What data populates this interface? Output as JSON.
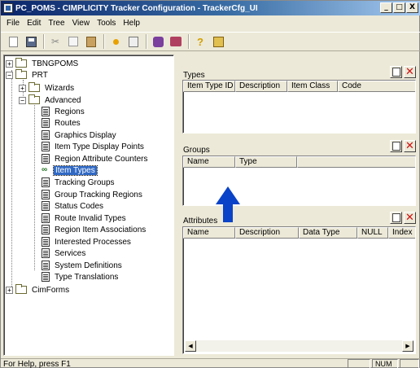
{
  "window": {
    "title": "PC_POMS - CIMPLICITY Tracker Configuration - TrackerCfg_UI",
    "minimize": "_",
    "maximize": "□",
    "close": "X"
  },
  "menu": [
    "File",
    "Edit",
    "Tree",
    "View",
    "Tools",
    "Help"
  ],
  "toolbar": [
    "new-icon",
    "save-icon",
    "cut-icon",
    "copy-icon",
    "paste-icon",
    "dot-icon",
    "filter-icon",
    "database-icon",
    "database-connect-icon",
    "help-icon",
    "sheet-icon"
  ],
  "tree": {
    "nodes": [
      {
        "label": "TBNGPOMS",
        "expander": "+"
      },
      {
        "label": "PRT",
        "expander": "−"
      },
      {
        "label": "Wizards",
        "expander": "+"
      },
      {
        "label": "Advanced",
        "expander": "−"
      },
      {
        "label": "Regions"
      },
      {
        "label": "Routes"
      },
      {
        "label": "Graphics Display"
      },
      {
        "label": "Item Type Display Points"
      },
      {
        "label": "Region Attribute Counters"
      },
      {
        "label": "Item Types"
      },
      {
        "label": "Tracking Groups"
      },
      {
        "label": "Group Tracking Regions"
      },
      {
        "label": "Status Codes"
      },
      {
        "label": "Route Invalid Types"
      },
      {
        "label": "Region Item Associations"
      },
      {
        "label": "Interested Processes"
      },
      {
        "label": "Services"
      },
      {
        "label": "System Definitions"
      },
      {
        "label": "Type Translations"
      },
      {
        "label": "CimForms",
        "expander": "+"
      }
    ]
  },
  "types_panel": {
    "label": "Types",
    "columns": [
      "Item Type ID",
      "Description",
      "Item Class",
      "Code"
    ]
  },
  "groups_panel": {
    "label": "Groups",
    "columns": [
      "Name",
      "Type"
    ]
  },
  "attributes_panel": {
    "label": "Attributes",
    "columns": [
      "Name",
      "Description",
      "Data Type",
      "NULL",
      "Index"
    ]
  },
  "status": {
    "help_text": "For Help, press F1",
    "num": "NUM"
  },
  "colors": {
    "title_start": "#0a246a",
    "selection": "#316ac5",
    "annotation_arrow": "#0a43c8",
    "delete_red": "#d01010"
  }
}
